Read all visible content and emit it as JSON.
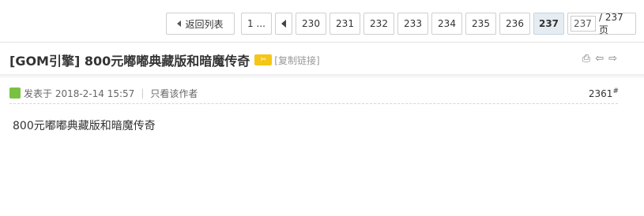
{
  "pagination": {
    "back_label": "返回列表",
    "first_label": "1 ...",
    "pages": [
      "230",
      "231",
      "232",
      "233",
      "234",
      "235",
      "236"
    ],
    "current": "237",
    "jump_value": "237",
    "total_label": "/ 237 页"
  },
  "thread": {
    "title": "[GOM引擎] 800元嘟嘟典藏版和暗魔传奇",
    "copy_link": "[复制链接]"
  },
  "post": {
    "posted_at": "发表于 2018-2-14 15:57",
    "only_author": "只看该作者",
    "floor": "2361",
    "floor_mark": "#",
    "content": "800元嘟嘟典藏版和暗魔传奇"
  }
}
